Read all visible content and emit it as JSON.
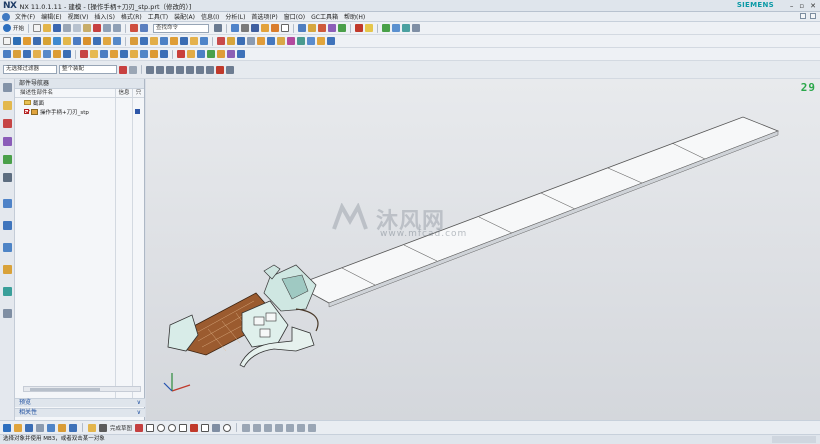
{
  "app": {
    "logo": "NX",
    "title": "NX 11.0.1.11 - 建模 - [操作手柄+刀刃_stp.prt（修改的）]",
    "brand": "SIEMENS"
  },
  "menu": {
    "items": [
      "文件(F)",
      "编辑(E)",
      "视图(V)",
      "插入(S)",
      "格式(R)",
      "工具(T)",
      "装配(A)",
      "信息(I)",
      "分析(L)",
      "首选项(P)",
      "窗口(O)",
      "GC工具箱",
      "帮助(H)"
    ]
  },
  "toolbar": {
    "start_label": "开始",
    "command_search_placeholder": "查找命令",
    "selection_filter": "无选择过滤器",
    "selection_scope": "整个装配"
  },
  "navigator": {
    "title": "部件导航器",
    "columns": {
      "name": "描述性部件名",
      "info": "信息",
      "last": "只"
    },
    "rows": [
      {
        "label": "截面"
      },
      {
        "label": "操作手柄+刀刃_stp"
      }
    ],
    "accordion": [
      "预览",
      "相关性"
    ]
  },
  "viewport": {
    "frame_counter": "29",
    "watermark_text": "沐风网",
    "watermark_url": "www.mfcad.com"
  },
  "bottom": {
    "snap_label": "完成草图"
  },
  "status": {
    "message": "选择对象并使用 MB3，或者双击某一对象"
  },
  "colors": {
    "accent": "#1e4fa0",
    "counter": "#2aa74a",
    "brand": "#0b9aa6"
  }
}
